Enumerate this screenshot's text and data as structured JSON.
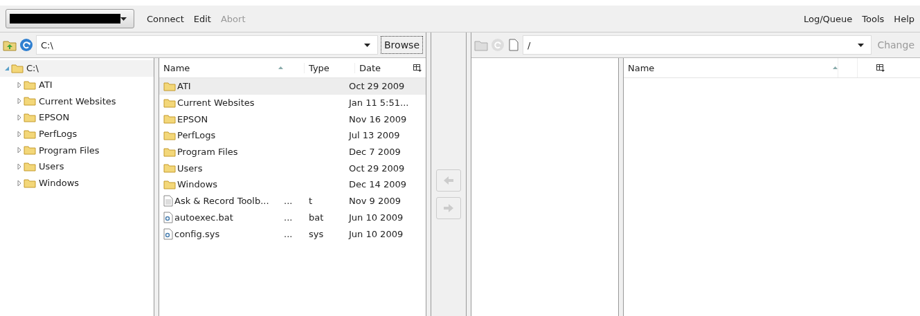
{
  "menu_left": [
    {
      "label": "Connect",
      "disabled": false
    },
    {
      "label": "Edit",
      "disabled": false
    },
    {
      "label": "Abort",
      "disabled": true
    }
  ],
  "menu_right": [
    {
      "label": "Log/Queue",
      "disabled": false
    },
    {
      "label": "Tools",
      "disabled": false
    },
    {
      "label": "Help",
      "disabled": false
    }
  ],
  "local": {
    "path": "C:\\",
    "button": {
      "label": "Browse",
      "disabled": false
    },
    "tree": [
      {
        "label": "C:\\",
        "expanded": true,
        "children": [
          {
            "label": "ATI",
            "expanded": false
          },
          {
            "label": "Current Websites",
            "expanded": false
          },
          {
            "label": "EPSON",
            "expanded": false
          },
          {
            "label": "PerfLogs",
            "expanded": false
          },
          {
            "label": "Program Files",
            "expanded": false
          },
          {
            "label": "Users",
            "expanded": false
          },
          {
            "label": "Windows",
            "expanded": false
          }
        ]
      }
    ],
    "columns": [
      "Name",
      "Type",
      "Date"
    ],
    "rows": [
      {
        "kind": "folder",
        "name": "ATI",
        "size": "",
        "type": "",
        "date": "Oct 29 2009",
        "selected": true
      },
      {
        "kind": "folder",
        "name": "Current Websites",
        "size": "",
        "type": "",
        "date": "Jan 11 5:51...",
        "selected": false
      },
      {
        "kind": "folder",
        "name": "EPSON",
        "size": "",
        "type": "",
        "date": "Nov 16 2009",
        "selected": false
      },
      {
        "kind": "folder",
        "name": "PerfLogs",
        "size": "",
        "type": "",
        "date": "Jul 13 2009",
        "selected": false
      },
      {
        "kind": "folder",
        "name": "Program Files",
        "size": "",
        "type": "",
        "date": "Dec 7 2009",
        "selected": false
      },
      {
        "kind": "folder",
        "name": "Users",
        "size": "",
        "type": "",
        "date": "Oct 29 2009",
        "selected": false
      },
      {
        "kind": "folder",
        "name": "Windows",
        "size": "",
        "type": "",
        "date": "Dec 14 2009",
        "selected": false
      },
      {
        "kind": "text",
        "name": "Ask & Record Toolb...",
        "size": "...",
        "type": "t",
        "date": "Nov 9 2009",
        "selected": false
      },
      {
        "kind": "system",
        "name": "autoexec.bat",
        "size": "...",
        "type": "bat",
        "date": "Jun 10 2009",
        "selected": false
      },
      {
        "kind": "system",
        "name": "config.sys",
        "size": "...",
        "type": "sys",
        "date": "Jun 10 2009",
        "selected": false
      }
    ]
  },
  "remote": {
    "path": "/",
    "button": {
      "label": "Change",
      "disabled": true
    },
    "columns": [
      "Name"
    ]
  }
}
